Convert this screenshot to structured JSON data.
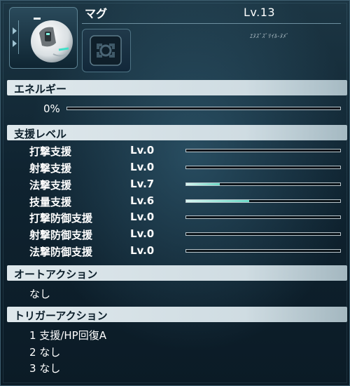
{
  "mag": {
    "name": "マグ",
    "level": "Lv.13",
    "tagline": "ｴﾇｽﾞｽﾞﾘｲﾙ-ﾇﾒﾞ"
  },
  "energy": {
    "header": "エネルギー",
    "percent": "0%",
    "value": 0
  },
  "support": {
    "header": "支援レベル",
    "rows": [
      {
        "label": "打撃支援",
        "level": "Lv.0",
        "progress": 0
      },
      {
        "label": "射撃支援",
        "level": "Lv.0",
        "progress": 0
      },
      {
        "label": "法撃支援",
        "level": "Lv.7",
        "progress": 0.22
      },
      {
        "label": "技量支援",
        "level": "Lv.6",
        "progress": 0.41
      },
      {
        "label": "打撃防御支援",
        "level": "Lv.0",
        "progress": 0
      },
      {
        "label": "射撃防御支援",
        "level": "Lv.0",
        "progress": 0
      },
      {
        "label": "法撃防御支援",
        "level": "Lv.0",
        "progress": 0
      }
    ]
  },
  "auto_action": {
    "header": "オートアクション",
    "value": "なし"
  },
  "trigger_action": {
    "header": "トリガーアクション",
    "items": [
      {
        "num": "1",
        "text": "支援/HP回復A"
      },
      {
        "num": "2",
        "text": "なし"
      },
      {
        "num": "3",
        "text": "なし"
      }
    ]
  },
  "colors": {
    "accent_fill": "#69d8c5",
    "header_bg": "#dfe8ec",
    "panel_bg": "#0f2330"
  }
}
